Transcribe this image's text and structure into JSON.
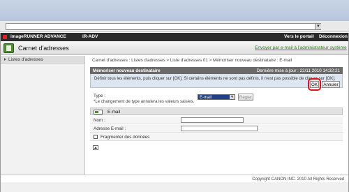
{
  "browser": {
    "address_value": ""
  },
  "brand": {
    "product": "imageRUNNER ADVANCE",
    "model": "iR-ADV",
    "portal_link": "Vers le portail",
    "logout": "Déconnexion"
  },
  "page": {
    "title": "Carnet d'adresses",
    "admin_link": "Envoyer par e-mail à l'administrateur système"
  },
  "sidebar": {
    "items": [
      {
        "label": "Listes d'adresses"
      }
    ]
  },
  "breadcrumb": "Carnet d'adresses : Listes d'adresses > Liste d'adresses 01 > Mémoriser nouveau destinataire : E-mail",
  "panel": {
    "title": "Mémoriser nouveau destinataire",
    "last_update": "Dernière mise à jour : 22/11 2010 14:32:21",
    "instructions": "Définir tous les éléments, puis cliquer sur [OK]. Si certains éléments ne sont pas définis, il n'est pas possible de cliquer sur [OK].",
    "ok_label": "OK",
    "cancel_label": "Annuler"
  },
  "type_field": {
    "label": "Type :",
    "selected": "E-mail",
    "apply_label": "Régler",
    "note": "*Le changement de type annulera les valeurs saisies."
  },
  "email_section": {
    "title": "E-mail",
    "name_label": "Nom :",
    "name_value": "",
    "address_label": "Adresse E-mail :",
    "address_value": "",
    "split_label": "Fragmenter des données",
    "split_checked": false
  },
  "footer": {
    "copyright": "Copyright CANON INC. 2010 All Rights Reserved"
  },
  "colors": {
    "highlight": "#d8141c",
    "title_green": "#4f8a36",
    "panel_head": "#6a6a6a"
  }
}
